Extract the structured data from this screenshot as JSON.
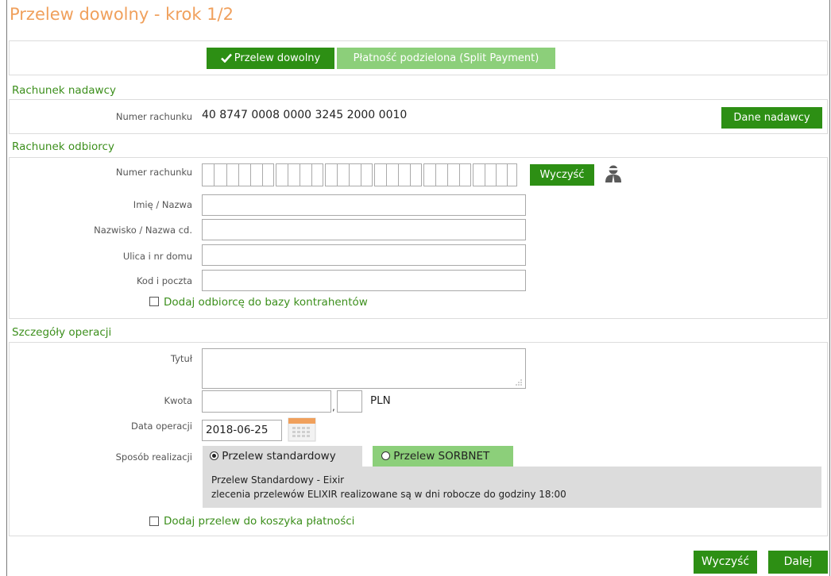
{
  "title": "Przelew dowolny - krok 1/2",
  "transfer_types": {
    "standard": "Przelew dowolny",
    "split": "Płatność podzielona (Split Payment)"
  },
  "sender": {
    "section_title": "Rachunek nadawcy",
    "account_label": "Numer rachunku",
    "account_number": "40 8747 0008 0000 3245 2000 0010",
    "details_button": "Dane nadawcy"
  },
  "recipient": {
    "section_title": "Rachunek odbiorcy",
    "account_label": "Numer rachunku",
    "account_value": "",
    "clear_button": "Wyczyść",
    "name_label": "Imię / Nazwa",
    "name_value": "",
    "surname_label": "Nazwisko / Nazwa cd.",
    "surname_value": "",
    "street_label": "Ulica i nr domu",
    "street_value": "",
    "postal_label": "Kod i poczta",
    "postal_value": "",
    "add_to_contacts_label": "Dodaj odbiorcę do bazy kontrahentów",
    "add_to_contacts_checked": false,
    "contacts_icon": "person-silhouette-icon"
  },
  "details": {
    "section_title": "Szczegóły operacji",
    "title_label": "Tytuł",
    "title_value": "",
    "amount_label": "Kwota",
    "amount_value": "",
    "amount_cents": "",
    "currency": "PLN",
    "date_label": "Data operacji",
    "date_value": "2018-06-25",
    "calendar_icon": "calendar-icon",
    "method_label": "Sposób realizacji",
    "methods": [
      {
        "label": "Przelew standardowy",
        "selected": true
      },
      {
        "label": "Przelew SORBNET",
        "selected": false
      }
    ],
    "info_line1": "Przelew Standardowy - Eixir",
    "info_line2": "zlecenia przelewów ELIXIR realizowane są w dni robocze do godziny 18:00",
    "add_to_basket_label": "Dodaj przelew do koszyka płatności",
    "add_to_basket_checked": false
  },
  "footer": {
    "clear_button": "Wyczyść",
    "next_button": "Dalej"
  },
  "colors": {
    "title": "#f0a05c",
    "section": "#3c8f1c",
    "button_dark": "#2d8f14",
    "button_light": "#8ccf7a",
    "info_bg": "#dcdcdc"
  }
}
